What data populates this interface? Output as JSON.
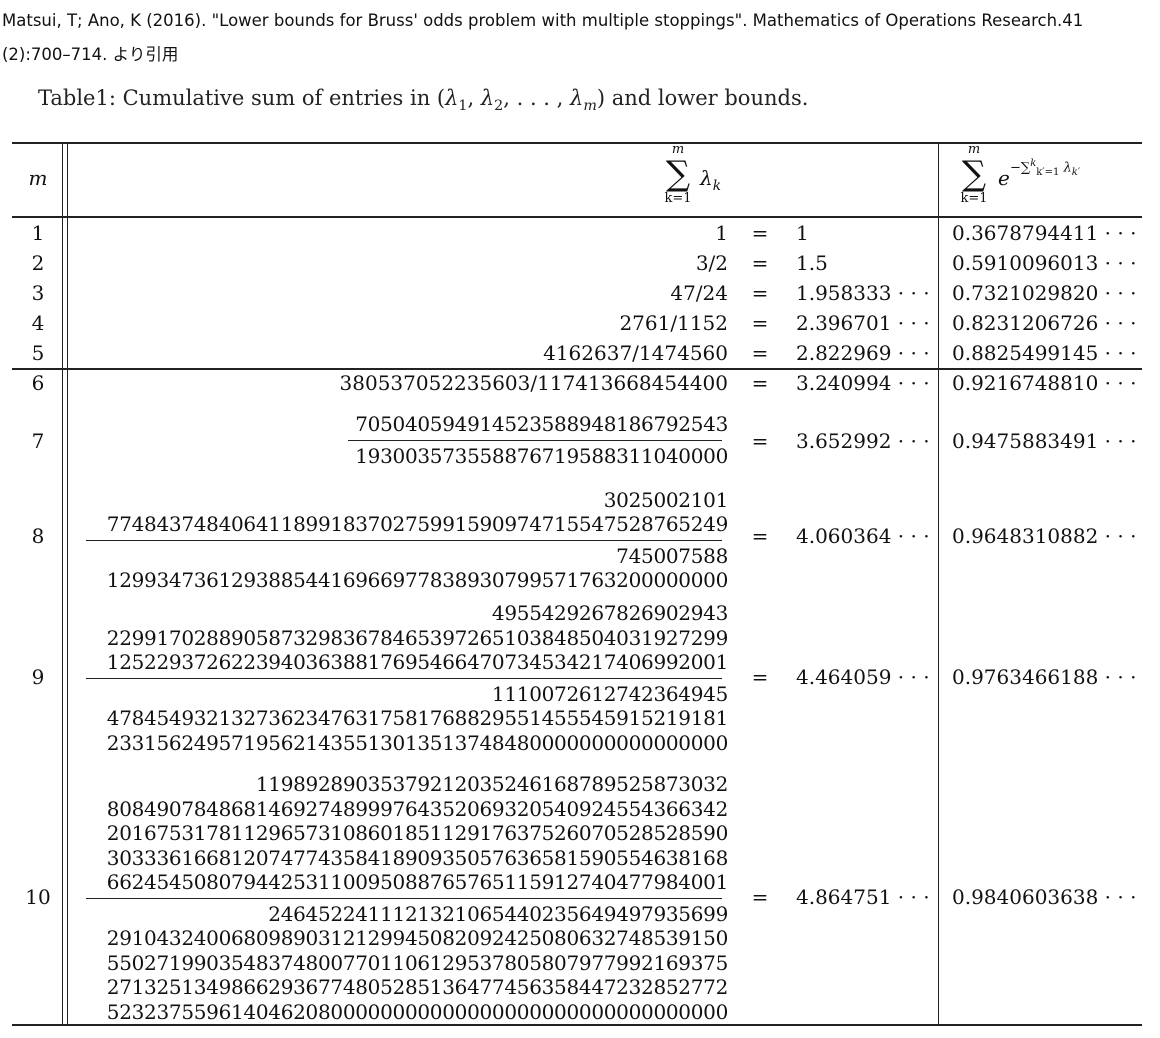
{
  "citation": "Matsui, T; Ano, K (2016). \"Lower bounds for Bruss' odds problem with multiple stoppings\". Mathematics of Operations Research. 41 (2): 700–714. より引用",
  "caption": {
    "prefix": "Table 1: Cumulative sum of entries in (",
    "lam": "λ",
    "s1": "1",
    "s2": "2",
    "sm": "m",
    "mid": ", ",
    "dots": ", . . . , ",
    "suffix": ") and lower bounds."
  },
  "header": {
    "m": "m",
    "sum_top": "m",
    "sum_sigma": "∑",
    "sum_bottom": "k=1",
    "sum_term": "λ",
    "sum_term_sub": "k",
    "bound_top": "m",
    "bound_sigma": "∑",
    "bound_bottom": "k=1",
    "bound_term": "e",
    "bound_exp": "−∑",
    "bound_exp_sup": "k",
    "bound_exp_sub": "k′=1",
    "bound_exp_term": "λ",
    "bound_exp_term_sub": "k′"
  },
  "rows": [
    {
      "m": "1",
      "value": "1",
      "eq": "=",
      "decimal": "1",
      "bound": "0.3678794411 · · ·"
    },
    {
      "m": "2",
      "value": "3/2",
      "eq": "=",
      "decimal": "1.5",
      "bound": "0.5910096013 · · ·"
    },
    {
      "m": "3",
      "value": "47/24",
      "eq": "=",
      "decimal": "1.958333 · · ·",
      "bound": "0.7321029820 · · ·"
    },
    {
      "m": "4",
      "value": "2761/1152",
      "eq": "=",
      "decimal": "2.396701 · · ·",
      "bound": "0.8231206726 · · ·"
    },
    {
      "m": "5",
      "value": "4162637/1474560",
      "eq": "=",
      "decimal": "2.822969 · · ·",
      "bound": "0.8825499145 · · ·"
    },
    {
      "m": "6",
      "value": "380537052235603/117413668454400",
      "eq": "=",
      "decimal": "3.240994 · · ·",
      "bound": "0.9216748810 · · ·"
    },
    {
      "m": "7",
      "numer": [
        "705040594914523588948186792543"
      ],
      "denom": [
        "193003573558876719588311040000"
      ],
      "eq": "=",
      "decimal": "3.652992 · · ·",
      "bound": "0.9475883491 · · ·"
    },
    {
      "m": "8",
      "numer": [
        "3025002101",
        "774843748406411899183702759915909747155475287652 49"
      ],
      "denom": [
        "745007588",
        "129934736129388544169669778389307995717632000000 00"
      ],
      "eq": "=",
      "decimal": "4.060364 · · ·",
      "bound": "0.9648310882 · · ·"
    },
    {
      "m": "9",
      "numer": [
        "4955429267826902943",
        "229917028890587329836784653972651038485040319272 99",
        "125229372622394036388176954664707345342174069920 01"
      ],
      "denom": [
        "1110072612742364945",
        "478454932132736234763175817688295514555459152191 81",
        "233156249571956214355130135137484800000000000000 00"
      ],
      "eq": "=",
      "decimal": "4.464059 · · ·",
      "bound": "0.9763466188 · · ·"
    },
    {
      "m": "10",
      "numer": [
        "11989289035379212035246168789525873032",
        "808490784868146927489997643520693205409245543663 42",
        "201675317811296573108601851129176375260705285285 90",
        "303336166812074774358418909350576365815905546381 68",
        "662454508079442531100950887657651159127404779840 01"
      ],
      "denom": [
        "24645224111213210654402356494979356 99",
        "291043240068098903121299450820924250806327485391 50",
        "550271990354837480077011061295378058079779921693 75",
        "271325134986629367748052851364774563584472328527 72",
        "523237559614046208000000000000000000000000000000 00"
      ],
      "eq": "=",
      "decimal": "4.864751 · · ·",
      "bound": "0.9840603638 · · ·"
    }
  ]
}
